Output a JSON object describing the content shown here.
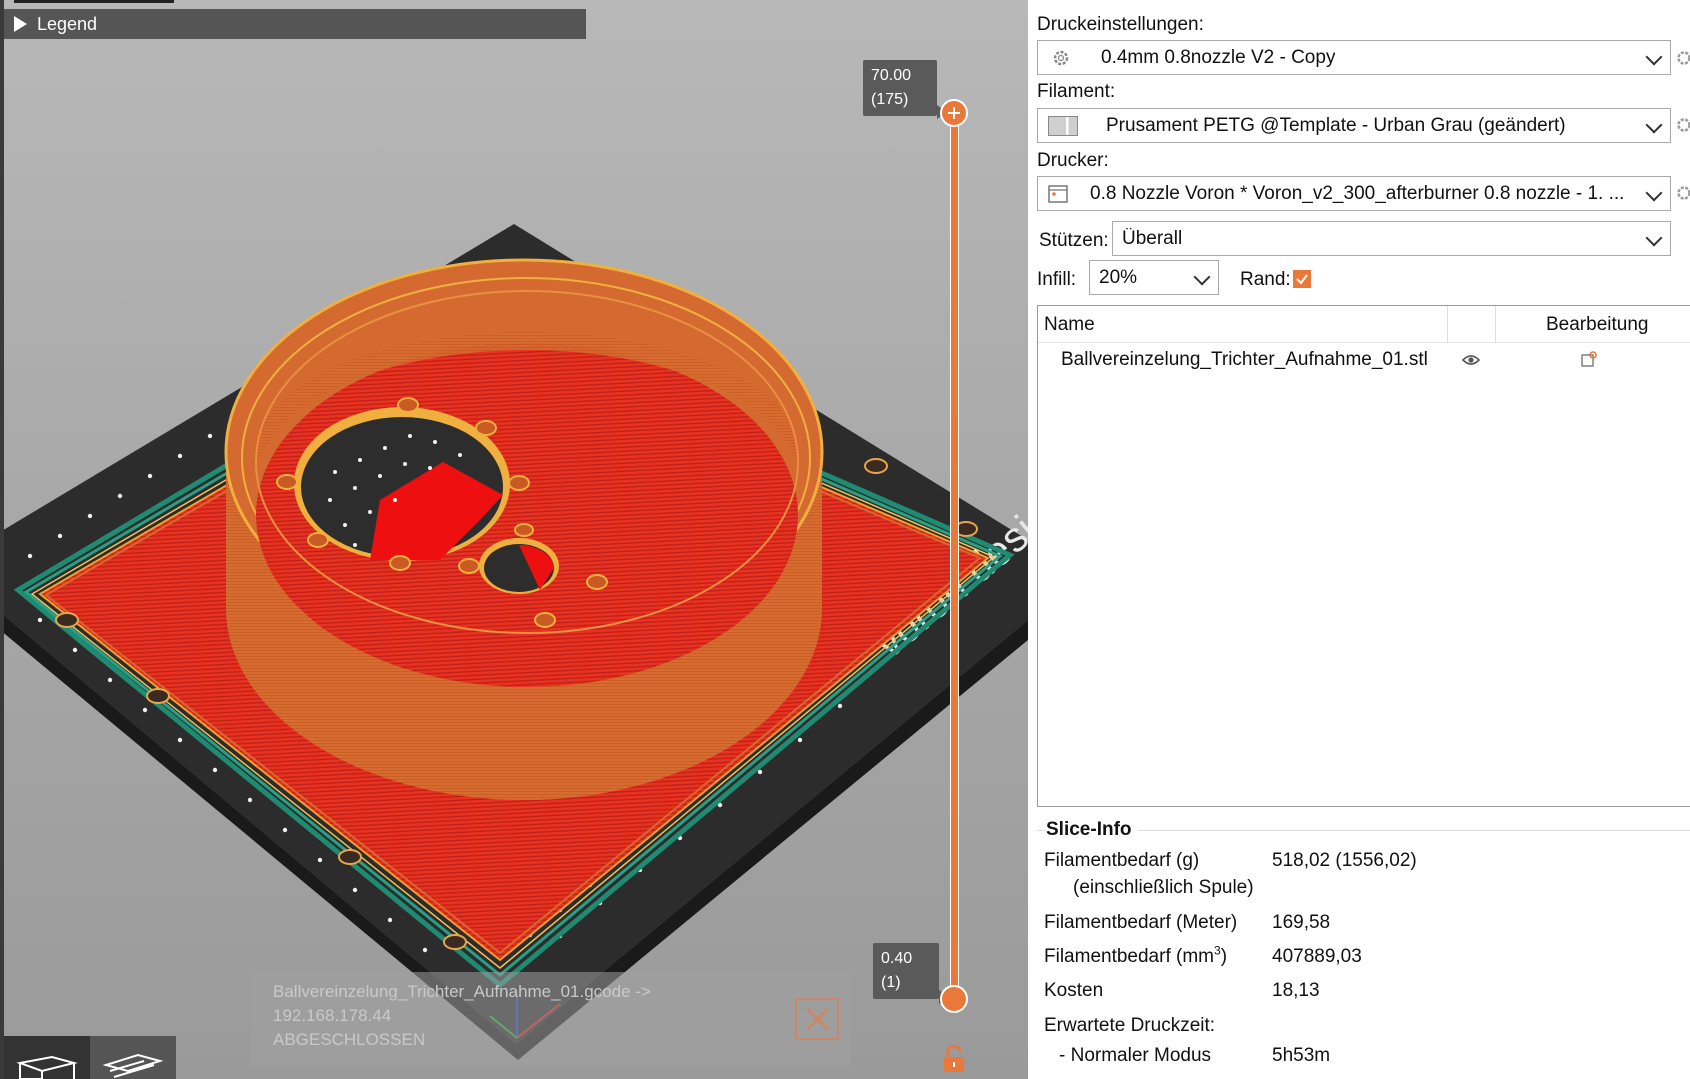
{
  "viewport": {
    "legend_label": "Legend",
    "layer_top": {
      "height": "70.00",
      "layer": "(175)"
    },
    "layer_bottom": {
      "height": "0.40",
      "layer": "(1)"
    },
    "bed_brand_text": "voron design",
    "notification": {
      "line1": "Ballvereinzelung_Trichter_Aufnahme_01.gcode ->",
      "line2": "192.168.178.44",
      "line3": "ABGESCHLOSSEN"
    },
    "toolbar": [
      "3d-view-icon",
      "layers-view-icon"
    ]
  },
  "panel": {
    "print_settings": {
      "label": "Druckeinstellungen:",
      "value": "0.4mm 0.8nozzle V2 - Copy"
    },
    "filament": {
      "label": "Filament:",
      "value": "Prusament PETG @Template - Urban Grau (geändert)"
    },
    "printer": {
      "label": "Drucker:",
      "value": "0.8 Nozzle Voron  * Voron_v2_300_afterburner 0.8 nozzle - 1. ..."
    },
    "supports": {
      "label": "Stützen:",
      "value": "Überall"
    },
    "infill": {
      "label": "Infill:",
      "value": "20%"
    },
    "brim": {
      "label": "Rand:",
      "checked": true
    },
    "object_list": {
      "col_name": "Name",
      "col_edit": "Bearbeitung",
      "items": [
        {
          "name": "Ballvereinzelung_Trichter_Aufnahme_01.stl"
        }
      ]
    },
    "slice_info": {
      "title": "Slice-Info",
      "filament_g_label": "Filamentbedarf (g)",
      "filament_g_sub": "(einschließlich Spule)",
      "filament_g_value": "518,02 (1556,02)",
      "filament_m_label": "Filamentbedarf (Meter)",
      "filament_m_value": "169,58",
      "filament_mm3_label": "Filamentbedarf (mm",
      "filament_mm3_sup": "3",
      "filament_mm3_label_end": ")",
      "filament_mm3_value": "407889,03",
      "cost_label": "Kosten",
      "cost_value": "18,13",
      "time_label": "Erwartete Druckzeit:",
      "normal_mode_label": "- Normaler Modus",
      "normal_mode_value": "5h53m"
    }
  },
  "colors": {
    "accent": "#e9793a",
    "part_orange": "#d5692e",
    "bed_red": "#e53020",
    "bed_dark": "#2d2d2d",
    "skirt_teal": "#1d8a72"
  }
}
